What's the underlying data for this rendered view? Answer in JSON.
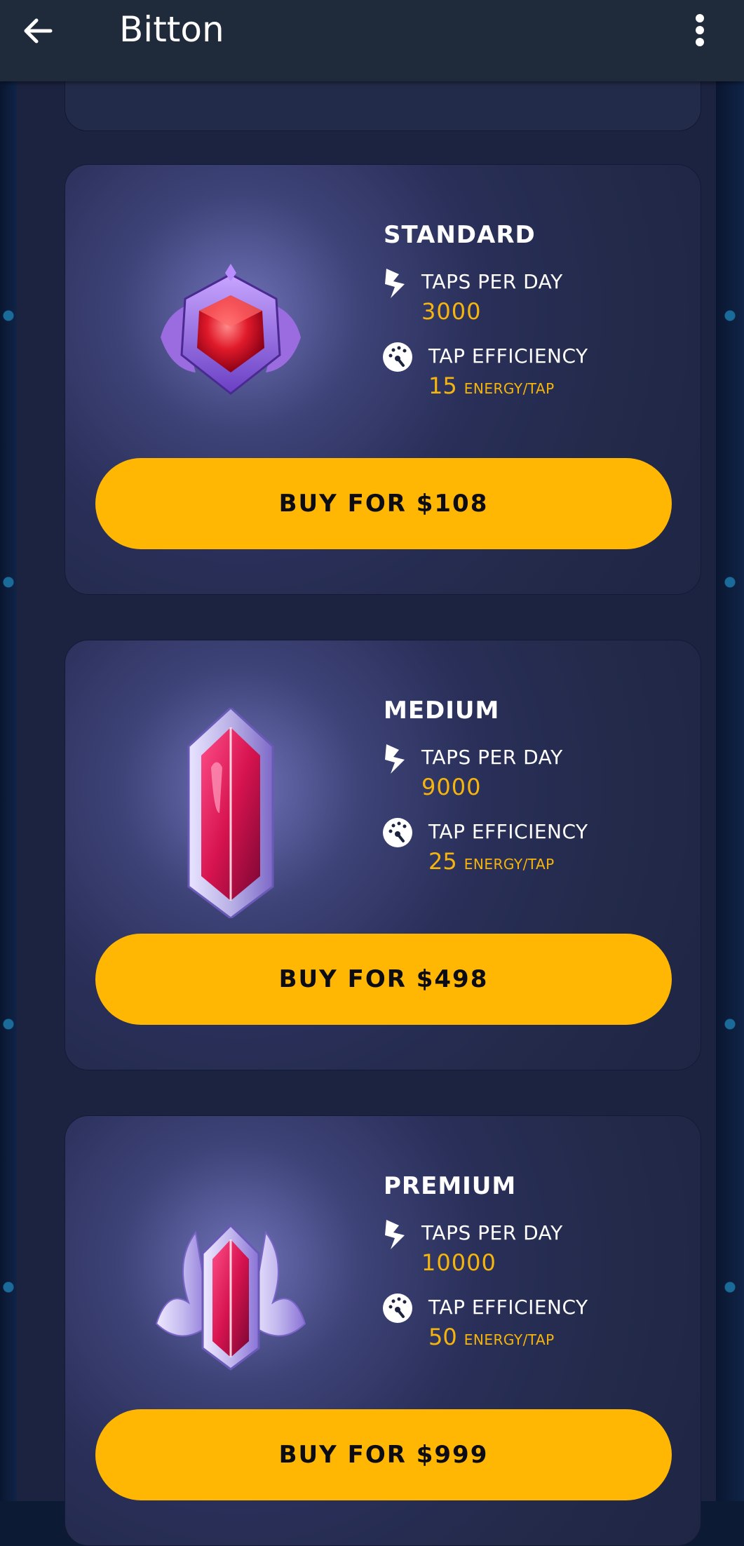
{
  "app_bar": {
    "title": "Bitton",
    "back_icon": "arrow-left-icon",
    "menu_icon": "more-vertical-icon"
  },
  "colors": {
    "accent": "#ffb703",
    "value": "#f6b50d",
    "appbar": "#1f2a3a",
    "panel": "#1c2340"
  },
  "plans": [
    {
      "name": "STANDARD",
      "taps_label": "TAPS PER DAY",
      "taps_value": "3000",
      "efficiency_label": "TAP EFFICIENCY",
      "efficiency_value": "15",
      "efficiency_unit": "ENERGY/TAP",
      "button_label": "BUY FOR $108",
      "badge_icon": "ruby-shield-icon"
    },
    {
      "name": "MEDIUM",
      "taps_label": "TAPS PER DAY",
      "taps_value": "9000",
      "efficiency_label": "TAP EFFICIENCY",
      "efficiency_value": "25",
      "efficiency_unit": "ENERGY/TAP",
      "button_label": "BUY FOR $498",
      "badge_icon": "crystal-icon"
    },
    {
      "name": "PREMIUM",
      "taps_label": "TAPS PER DAY",
      "taps_value": "10000",
      "efficiency_label": "TAP EFFICIENCY",
      "efficiency_value": "50",
      "efficiency_unit": "ENERGY/TAP",
      "button_label": "BUY FOR $999",
      "badge_icon": "horned-crystal-icon"
    }
  ]
}
